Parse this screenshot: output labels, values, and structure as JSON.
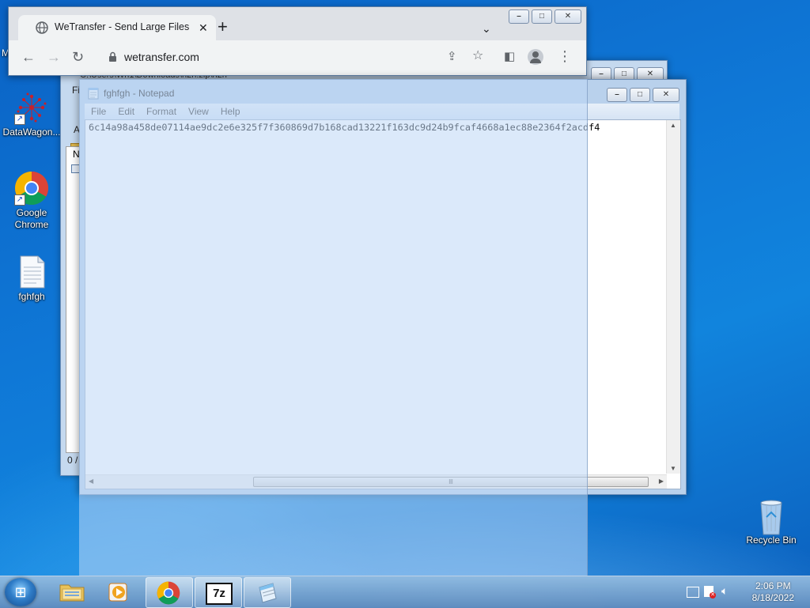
{
  "desktop": {
    "icons": [
      {
        "label": "DataWagon..."
      },
      {
        "label": "Google Chrome"
      },
      {
        "label": "fghfgh"
      },
      {
        "label": "Recycle Bin"
      }
    ],
    "edge_fragment": "M"
  },
  "chrome": {
    "tab_title": "WeTransfer - Send Large Files &",
    "url": "wetransfer.com",
    "new_tab": "+"
  },
  "explorer": {
    "path": "C:\\Users\\Wn1\\Downloads\\h2h.zip\\h2h",
    "fragments": [
      "Fi",
      "A",
      "N",
      "0 /"
    ]
  },
  "notepad": {
    "title": "fghfgh - Notepad",
    "menu": [
      "File",
      "Edit",
      "Format",
      "View",
      "Help"
    ],
    "content": "6c14a98a458de07114ae9dc2e6e325f7f360869d7b168cad13221f163dc9d24b9fcaf4668a1ec88e2364f2acdf4",
    "scroll_grip": "lll"
  },
  "taskbar": {
    "clock_time": "2:06 PM",
    "clock_date": "8/18/2022",
    "sevenzip_label": "7z",
    "accent": "#1a6fd0"
  }
}
